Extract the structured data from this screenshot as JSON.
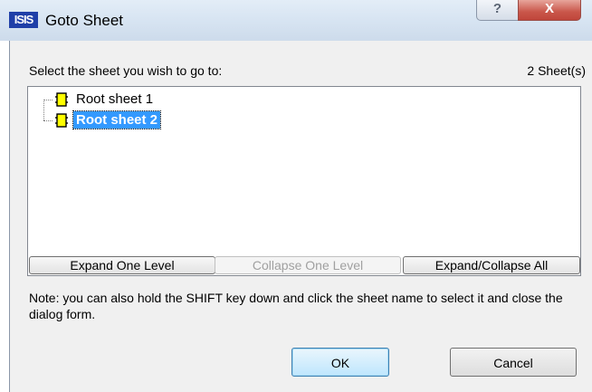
{
  "window": {
    "title": "Goto Sheet",
    "app_icon_text": "ISIS",
    "help_label": "?",
    "close_label": "X"
  },
  "dialog": {
    "prompt": "Select the sheet you wish to go to:",
    "sheet_count": "2 Sheet(s)",
    "tree": [
      {
        "label": "Root sheet 1",
        "selected": false,
        "icon": "sheet-icon"
      },
      {
        "label": "Root sheet 2",
        "selected": true,
        "icon": "sheet-icon"
      }
    ],
    "buttons": {
      "expand_one": "Expand One Level",
      "collapse_one": "Collapse One Level",
      "expand_collapse_all": "Expand/Collapse All"
    },
    "note": "Note: you can also hold the SHIFT key down and click the sheet name to select it and close the dialog form.",
    "ok": "OK",
    "cancel": "Cancel"
  },
  "colors": {
    "selection": "#3399ff",
    "icon_fill": "#ffff00"
  }
}
